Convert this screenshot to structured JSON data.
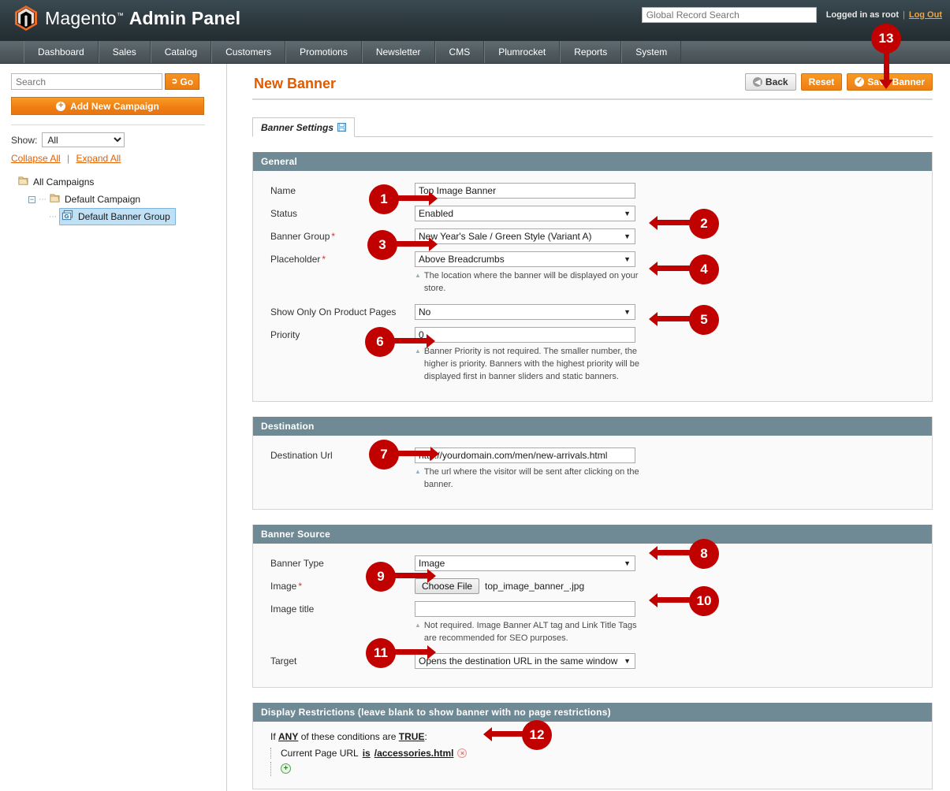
{
  "header": {
    "brand_main": "Magento",
    "brand_tm": "™",
    "brand_sub": "Admin Panel",
    "search_placeholder": "Global Record Search",
    "search_value": "",
    "logged_in_text": "Logged in as root",
    "separator": "|",
    "logout_label": "Log Out",
    "logo_icon": "magento-hexagon-icon"
  },
  "nav": {
    "items": [
      {
        "label": "Dashboard"
      },
      {
        "label": "Sales"
      },
      {
        "label": "Catalog"
      },
      {
        "label": "Customers"
      },
      {
        "label": "Promotions"
      },
      {
        "label": "Newsletter"
      },
      {
        "label": "CMS"
      },
      {
        "label": "Plumrocket"
      },
      {
        "label": "Reports"
      },
      {
        "label": "System"
      }
    ]
  },
  "sidebar": {
    "search_placeholder": "Search",
    "go_label": "Go",
    "go_icon": "go-arrow-icon",
    "add_campaign_label": "Add New Campaign",
    "add_icon": "plus-circle-icon",
    "show_label": "Show:",
    "show_value": "All",
    "show_options": [
      "All"
    ],
    "collapse_all": "Collapse All",
    "separator": "|",
    "expand_all": "Expand All",
    "tree": [
      {
        "label": "All Campaigns",
        "icon": "folder-icon",
        "level": 1,
        "selected": false,
        "expander": ""
      },
      {
        "label": "Default Campaign",
        "icon": "folder-icon",
        "level": 2,
        "selected": false,
        "expander": "−"
      },
      {
        "label": "Default Banner Group",
        "icon": "banner-group-icon",
        "level": 3,
        "selected": true,
        "expander": ""
      }
    ]
  },
  "main": {
    "page_title": "New Banner",
    "buttons": {
      "back": "Back",
      "reset": "Reset",
      "save": "Save Banner",
      "back_icon": "back-arrow-icon",
      "save_icon": "check-circle-icon"
    },
    "tab": {
      "label": "Banner Settings",
      "icon": "save-floppy-icon"
    },
    "sections": [
      {
        "id": "general",
        "title": "General",
        "rows": [
          {
            "label": "Name",
            "required": false,
            "type": "input",
            "value": "Top Image Banner",
            "hint": ""
          },
          {
            "label": "Status",
            "required": false,
            "type": "select",
            "value": "Enabled",
            "hint": ""
          },
          {
            "label": "Banner Group",
            "required": true,
            "type": "select",
            "value": "New Year's Sale / Green Style (Variant A)",
            "hint": ""
          },
          {
            "label": "Placeholder",
            "required": true,
            "type": "select",
            "value": "Above Breadcrumbs",
            "hint": "The location where the banner will be displayed on your store."
          },
          {
            "label": "Show Only On Product Pages",
            "required": false,
            "type": "select",
            "value": "No",
            "hint": ""
          },
          {
            "label": "Priority",
            "required": false,
            "type": "input",
            "value": "0",
            "hint": "Banner Priority is not required. The smaller number, the higher is priority. Banners with the highest priority will be displayed first in banner sliders and static banners."
          }
        ]
      },
      {
        "id": "destination",
        "title": "Destination",
        "rows": [
          {
            "label": "Destination Url",
            "required": false,
            "type": "input",
            "value": "http://yourdomain.com/men/new-arrivals.html",
            "hint": "The url where the visitor will be sent after clicking on the banner."
          }
        ]
      },
      {
        "id": "banner-source",
        "title": "Banner Source",
        "rows": [
          {
            "label": "Banner Type",
            "required": false,
            "type": "select",
            "value": "Image",
            "hint": ""
          },
          {
            "label": "Image",
            "required": true,
            "type": "file",
            "value": "top_image_banner_.jpg",
            "file_button": "Choose File",
            "hint": ""
          },
          {
            "label": "Image title",
            "required": false,
            "type": "input",
            "value": "",
            "hint": "Not required. Image Banner ALT tag and Link Title Tags are recommended for SEO purposes."
          },
          {
            "label": "Target",
            "required": false,
            "type": "select",
            "value": "Opens the destination URL in the same window",
            "hint": ""
          }
        ]
      }
    ],
    "restrictions": {
      "title": "Display Restrictions (leave blank to show banner with no page restrictions)",
      "if_text": "If",
      "any_text": "ANY",
      "conditions_text": "of these conditions are",
      "true_text": "TRUE",
      "colon": ":",
      "condition_subject": "Current Page URL",
      "condition_operator": "is",
      "condition_value": "/accessories.html",
      "remove_icon": "remove-circle-icon",
      "add_icon": "add-circle-icon"
    }
  },
  "callouts": {
    "color": "#c10000",
    "items": [
      {
        "n": "1"
      },
      {
        "n": "2"
      },
      {
        "n": "3"
      },
      {
        "n": "4"
      },
      {
        "n": "5"
      },
      {
        "n": "6"
      },
      {
        "n": "7"
      },
      {
        "n": "8"
      },
      {
        "n": "9"
      },
      {
        "n": "10"
      },
      {
        "n": "11"
      },
      {
        "n": "12"
      },
      {
        "n": "13"
      }
    ]
  },
  "colors": {
    "brand_orange": "#ee7f12",
    "title_orange": "#e05a00",
    "section_header": "#6f8a95",
    "callout_red": "#c10000",
    "header_dark": "#2e3b41"
  }
}
